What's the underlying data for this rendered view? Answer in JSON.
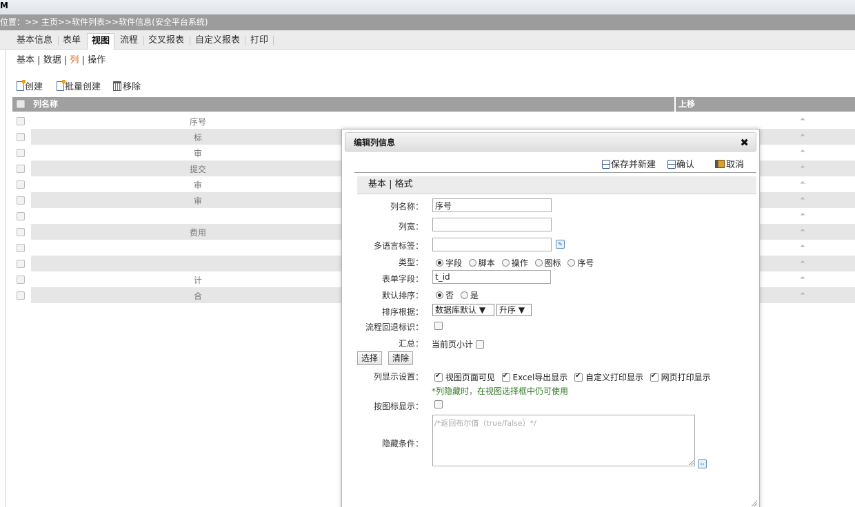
{
  "app": {
    "logo_text": "M"
  },
  "breadcrumb": "位置：>> 主页>>软件列表>>软件信息(安全平台系统)",
  "tabs": [
    {
      "label": "基本信息"
    },
    {
      "label": "表单"
    },
    {
      "label": "视图",
      "active": true
    },
    {
      "label": "流程"
    },
    {
      "label": "交叉报表"
    },
    {
      "label": "自定义报表"
    },
    {
      "label": "打印"
    }
  ],
  "subnav": {
    "items": [
      "基本",
      "数据",
      "列",
      "操作"
    ],
    "current": "列",
    "separator": "|"
  },
  "toolbar": {
    "create": "创建",
    "batch_create": "批量创建",
    "remove": "移除"
  },
  "grid": {
    "col_name": "列名称",
    "col_up": "上移",
    "up_glyph": "⏶",
    "rows": [
      "序号",
      "标",
      "审",
      "提交",
      "审",
      "审",
      "",
      "费用",
      "",
      "",
      "计",
      "合"
    ]
  },
  "dialog": {
    "title": "编辑列信息",
    "close_glyph": "✖",
    "actions": {
      "save_new": "保存并新建",
      "confirm": "确认",
      "cancel": "取消"
    },
    "tabs": "基本 | 格式",
    "fields": {
      "col_name": {
        "label": "列名称：",
        "value": "序号"
      },
      "col_width": {
        "label": "列宽：",
        "value": ""
      },
      "i18n": {
        "label": "多语言标签：",
        "value": ""
      },
      "type": {
        "label": "类型：",
        "options": [
          "字段",
          "脚本",
          "操作",
          "图标",
          "序号"
        ],
        "selected": "字段"
      },
      "form_field": {
        "label": "表单字段：",
        "value": "t_id"
      },
      "default_sort": {
        "label": "默认排序：",
        "options": [
          "否",
          "是"
        ],
        "selected": "否"
      },
      "sort_by": {
        "label": "排序根据：",
        "value": "数据库默认",
        "order": "升序"
      },
      "flow_back": {
        "label": "流程回退标识："
      },
      "summary": {
        "label": "汇总：",
        "text": "当前页小计"
      },
      "select_btn": "选择",
      "clear_btn": "清除",
      "display": {
        "label": "列显示设置：",
        "options": [
          "视图页面可见",
          "Excel导出显示",
          "自定义打印显示",
          "网页打印显示"
        ],
        "hint": "*列隐藏时，在视图选择框中仍可使用"
      },
      "icon_display": {
        "label": "按图标显示："
      },
      "hide_cond": {
        "label": "隐藏条件：",
        "placeholder": "/*返回布尔值（true/false）*/"
      }
    }
  },
  "colors": {
    "breadcrumb_bg": "#9c9c9c",
    "header_bg": "#a0a0a0",
    "active_subnav": "#d2691e",
    "hint": "#3a7d2c"
  }
}
